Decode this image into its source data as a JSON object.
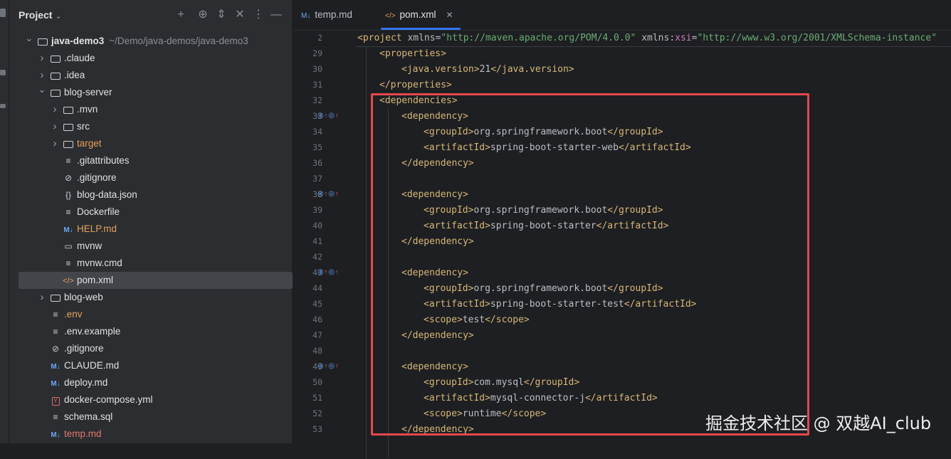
{
  "project": {
    "title": "Project",
    "tree": [
      {
        "label": "java-demo3",
        "path": "~/Demo/java-demos/java-demo3",
        "icon": "folder",
        "expanded": true,
        "depth": 0
      },
      {
        "label": ".claude",
        "icon": "folder",
        "expanded": false,
        "depth": 1
      },
      {
        "label": ".idea",
        "icon": "folder",
        "expanded": false,
        "depth": 1
      },
      {
        "label": "blog-server",
        "icon": "folder",
        "expanded": true,
        "depth": 1
      },
      {
        "label": ".mvn",
        "icon": "folder",
        "expanded": false,
        "depth": 2
      },
      {
        "label": "src",
        "icon": "folder",
        "expanded": false,
        "depth": 2
      },
      {
        "label": "target",
        "icon": "folder",
        "expanded": false,
        "depth": 2,
        "color": "orange"
      },
      {
        "label": ".gitattributes",
        "icon": "text",
        "depth": 2
      },
      {
        "label": ".gitignore",
        "icon": "ignore",
        "depth": 2
      },
      {
        "label": "blog-data.json",
        "icon": "json",
        "depth": 2
      },
      {
        "label": "Dockerfile",
        "icon": "text",
        "depth": 2
      },
      {
        "label": "HELP.md",
        "icon": "markdown",
        "depth": 2,
        "color": "orange"
      },
      {
        "label": "mvnw",
        "icon": "terminal",
        "depth": 2
      },
      {
        "label": "mvnw.cmd",
        "icon": "text",
        "depth": 2
      },
      {
        "label": "pom.xml",
        "icon": "xml",
        "depth": 2,
        "selected": true
      },
      {
        "label": "blog-web",
        "icon": "folder",
        "expanded": false,
        "depth": 1
      },
      {
        "label": ".env",
        "icon": "text",
        "depth": 1,
        "color": "orange"
      },
      {
        "label": ".env.example",
        "icon": "text",
        "depth": 1
      },
      {
        "label": ".gitignore",
        "icon": "ignore",
        "depth": 1
      },
      {
        "label": "CLAUDE.md",
        "icon": "markdown",
        "depth": 1
      },
      {
        "label": "deploy.md",
        "icon": "markdown",
        "depth": 1
      },
      {
        "label": "docker-compose.yml",
        "icon": "yaml",
        "depth": 1
      },
      {
        "label": "schema.sql",
        "icon": "text",
        "depth": 1
      },
      {
        "label": "temp.md",
        "icon": "markdown",
        "depth": 1,
        "color": "red"
      }
    ]
  },
  "tabs": [
    {
      "label": "temp.md",
      "icon": "M↓",
      "active": false
    },
    {
      "label": "pom.xml",
      "icon": "</>",
      "active": true
    }
  ],
  "icons": {
    "chevron": "chevron-down-icon",
    "add": "add-icon",
    "locate": "locate-icon",
    "expand": "expand-all-icon",
    "collapse": "collapse-all-icon",
    "more": "more-icon",
    "minimize": "minimize-icon",
    "close": "close-icon"
  },
  "editor": {
    "sticky_line": {
      "number": "2",
      "tokens": [
        [
          "tag",
          "<project "
        ],
        [
          "attr",
          "xmlns"
        ],
        [
          "txt",
          "="
        ],
        [
          "str",
          "\"http://maven.apache.org/POM/4.0.0\""
        ],
        [
          "txt",
          " "
        ],
        [
          "attr",
          "xmlns"
        ],
        [
          "txt",
          ":"
        ],
        [
          "ns",
          "xsi"
        ],
        [
          "txt",
          "="
        ],
        [
          "str",
          "\"http://www.w3.org/2001/XMLSchema-instance\""
        ]
      ]
    },
    "lines": [
      {
        "number": "29",
        "indent": 1,
        "tokens": [
          [
            "tag",
            "<properties>"
          ]
        ]
      },
      {
        "number": "30",
        "indent": 2,
        "tokens": [
          [
            "tag",
            "<java.version>"
          ],
          [
            "txt",
            "21"
          ],
          [
            "tag",
            "</java.version>"
          ]
        ]
      },
      {
        "number": "31",
        "indent": 1,
        "tokens": [
          [
            "tag",
            "</properties>"
          ]
        ]
      },
      {
        "number": "32",
        "indent": 1,
        "tokens": [
          [
            "tag",
            "<dependencies>"
          ]
        ]
      },
      {
        "number": "33",
        "indent": 2,
        "gutter": true,
        "tokens": [
          [
            "tag",
            "<dependency>"
          ]
        ]
      },
      {
        "number": "34",
        "indent": 3,
        "tokens": [
          [
            "tag",
            "<groupId>"
          ],
          [
            "txt",
            "org.springframework.boot"
          ],
          [
            "tag",
            "</groupId>"
          ]
        ]
      },
      {
        "number": "35",
        "indent": 3,
        "tokens": [
          [
            "tag",
            "<artifactId>"
          ],
          [
            "txt",
            "spring-boot-starter-web"
          ],
          [
            "tag",
            "</artifactId>"
          ]
        ]
      },
      {
        "number": "36",
        "indent": 2,
        "tokens": [
          [
            "tag",
            "</dependency>"
          ]
        ]
      },
      {
        "number": "37",
        "indent": 0,
        "tokens": []
      },
      {
        "number": "38",
        "indent": 2,
        "gutter": true,
        "tokens": [
          [
            "tag",
            "<dependency>"
          ]
        ]
      },
      {
        "number": "39",
        "indent": 3,
        "tokens": [
          [
            "tag",
            "<groupId>"
          ],
          [
            "txt",
            "org.springframework.boot"
          ],
          [
            "tag",
            "</groupId>"
          ]
        ]
      },
      {
        "number": "40",
        "indent": 3,
        "tokens": [
          [
            "tag",
            "<artifactId>"
          ],
          [
            "txt",
            "spring-boot-starter"
          ],
          [
            "tag",
            "</artifactId>"
          ]
        ]
      },
      {
        "number": "41",
        "indent": 2,
        "tokens": [
          [
            "tag",
            "</dependency>"
          ]
        ]
      },
      {
        "number": "42",
        "indent": 0,
        "tokens": []
      },
      {
        "number": "43",
        "indent": 2,
        "gutter": true,
        "tokens": [
          [
            "tag",
            "<dependency>"
          ]
        ]
      },
      {
        "number": "44",
        "indent": 3,
        "tokens": [
          [
            "tag",
            "<groupId>"
          ],
          [
            "txt",
            "org.springframework.boot"
          ],
          [
            "tag",
            "</groupId>"
          ]
        ]
      },
      {
        "number": "45",
        "indent": 3,
        "tokens": [
          [
            "tag",
            "<artifactId>"
          ],
          [
            "txt",
            "spring-boot-starter-test"
          ],
          [
            "tag",
            "</artifactId>"
          ]
        ]
      },
      {
        "number": "46",
        "indent": 3,
        "tokens": [
          [
            "tag",
            "<scope>"
          ],
          [
            "txt",
            "test"
          ],
          [
            "tag",
            "</scope>"
          ]
        ]
      },
      {
        "number": "47",
        "indent": 2,
        "tokens": [
          [
            "tag",
            "</dependency>"
          ]
        ]
      },
      {
        "number": "48",
        "indent": 0,
        "tokens": []
      },
      {
        "number": "49",
        "indent": 2,
        "gutter": true,
        "tokens": [
          [
            "tag",
            "<dependency>"
          ]
        ]
      },
      {
        "number": "50",
        "indent": 3,
        "tokens": [
          [
            "tag",
            "<groupId>"
          ],
          [
            "txt",
            "com.mysql"
          ],
          [
            "tag",
            "</groupId>"
          ]
        ]
      },
      {
        "number": "51",
        "indent": 3,
        "tokens": [
          [
            "tag",
            "<artifactId>"
          ],
          [
            "txt",
            "mysql-connector-j"
          ],
          [
            "tag",
            "</artifactId>"
          ]
        ]
      },
      {
        "number": "52",
        "indent": 3,
        "tokens": [
          [
            "tag",
            "<scope>"
          ],
          [
            "txt",
            "runtime"
          ],
          [
            "tag",
            "</scope>"
          ]
        ]
      },
      {
        "number": "53",
        "indent": 2,
        "tokens": [
          [
            "tag",
            "</dependency>"
          ]
        ]
      }
    ]
  },
  "watermark": "掘金技术社区 @ 双越AI_club",
  "colors": {
    "accent": "#3574f0",
    "highlight_box": "#e5484d",
    "tag": "#d5b778",
    "string": "#6aab73"
  }
}
